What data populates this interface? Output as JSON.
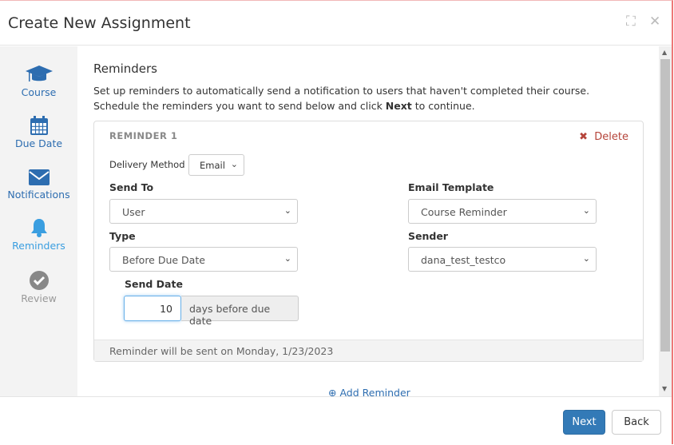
{
  "dialog": {
    "title": "Create New Assignment"
  },
  "sidebar": {
    "items": [
      {
        "label": "Course",
        "icon": "graduation-cap-icon",
        "state": "done"
      },
      {
        "label": "Due Date",
        "icon": "calendar-icon",
        "state": "done"
      },
      {
        "label": "Notifications",
        "icon": "envelope-icon",
        "state": "done"
      },
      {
        "label": "Reminders",
        "icon": "bell-icon",
        "state": "active"
      },
      {
        "label": "Review",
        "icon": "check-circle-icon",
        "state": "disabled"
      }
    ]
  },
  "section": {
    "title": "Reminders",
    "desc_1": "Set up reminders to automatically send a notification to users that haven't completed their course. Schedule the reminders you want to send below and click ",
    "desc_bold": "Next",
    "desc_2": " to continue."
  },
  "reminder": {
    "title": "REMINDER 1",
    "delete_label": "Delete",
    "delivery_label": "Delivery Method",
    "delivery_value": "Email",
    "send_to_label": "Send To",
    "send_to_value": "User",
    "template_label": "Email Template",
    "template_value": "Course Reminder",
    "type_label": "Type",
    "type_value": "Before Due Date",
    "sender_label": "Sender",
    "sender_value": "dana_test_testco",
    "send_date_label": "Send Date",
    "send_date_value": "10",
    "send_date_suffix": "days before due date",
    "note": "Reminder will be sent on Monday, 1/23/2023"
  },
  "add_reminder_label": "Add Reminder",
  "footer": {
    "next_label": "Next",
    "back_label": "Back"
  },
  "colors": {
    "accent": "#337ab7",
    "active": "#3a9ee0",
    "delete": "#b5443a"
  }
}
